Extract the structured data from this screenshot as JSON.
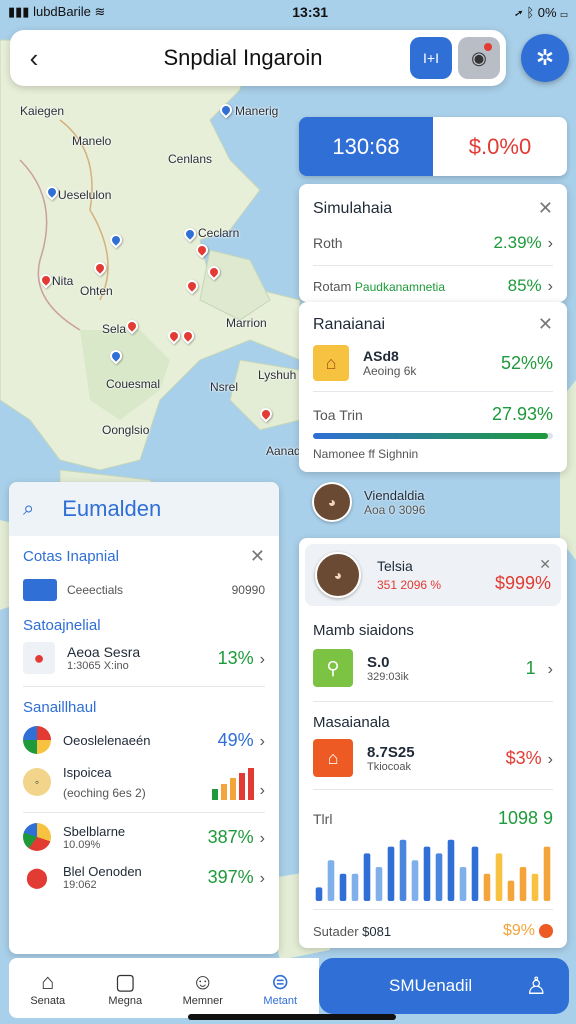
{
  "status": {
    "carrier": "lubdBarile",
    "time": "13:31",
    "battery": "0%"
  },
  "header": {
    "title": "Snpdial Ingaroin",
    "blue_button_label": "I+I"
  },
  "map": {
    "labels": [
      "Kaiegen",
      "Manerig",
      "Manelo",
      "Cenlans",
      "Ueselulon",
      "Ceclarn",
      "Ohten",
      "Nita",
      "Sela",
      "Marrion",
      "Lyshuh",
      "Nsrel",
      "Couesmal",
      "Oonglsio",
      "Aanad"
    ]
  },
  "stats": {
    "left": "130:68",
    "right": "$.0%0"
  },
  "sim_card": {
    "title": "Simulahaia",
    "rows": [
      {
        "label": "Roth",
        "value": "2.39%"
      },
      {
        "label": "Rotam",
        "sub": "Paudkanamnetia",
        "value": "85%"
      }
    ]
  },
  "ran_card": {
    "title": "Ranaianai",
    "item_title": "ASd8",
    "item_sub": "Aeoing 6k",
    "item_value": "52%%",
    "bottom_label": "Toa Trin",
    "bottom_value": "27.93%",
    "progress": 0.98,
    "footer": "Namonee ff Sighnin"
  },
  "profile_chip": {
    "name": "Viendaldia",
    "sub": "Aoa 0 3096"
  },
  "search": {
    "text": "Eumalden"
  },
  "left_list": {
    "section1": {
      "title": "Cotas Inapnial",
      "row_label": "Ceeectials",
      "row_value": "90990"
    },
    "section2": {
      "title": "Satoajnelial",
      "item_title": "Aeoa Sesra",
      "item_sub": "1:3065 X:ino",
      "item_value": "13%"
    },
    "section3": {
      "title": "Sanaillhaul",
      "rows": [
        {
          "title": "Oeoslelenaeén",
          "sub": "",
          "value": "49%"
        },
        {
          "title": "Ispoicea",
          "sub": "(eoching 6es 2)",
          "value": ""
        },
        {
          "title": "Sbelblarne",
          "sub": "10.09%",
          "value": "387%"
        },
        {
          "title": "Blel Oenoden",
          "sub": "19:062",
          "value": "397%"
        }
      ]
    }
  },
  "right_list": {
    "profile": {
      "name": "Telsia",
      "sub": "351 2096 %",
      "value": "$999%"
    },
    "item1": {
      "heading": "Mamb siaidons",
      "title": "S.0",
      "sub": "329:03ik",
      "value": "1"
    },
    "item2": {
      "heading": "Masaianala",
      "title": "8.7S25",
      "sub": "Tkiocoak",
      "value": "$3%"
    },
    "chart_label": "Tlrl",
    "chart_value": "1098 9",
    "footer_label": "Sutader",
    "footer_value": "$081",
    "footer_percent": "$9%"
  },
  "chart_data": {
    "type": "bar",
    "values": [
      2,
      6,
      4,
      4,
      7,
      5,
      8,
      9,
      6,
      8,
      7,
      9,
      5,
      8,
      4,
      7,
      3,
      5,
      4,
      8
    ],
    "ylim": [
      0,
      10
    ],
    "colors": [
      "#2f6fd6",
      "#7fb0ea",
      "#2f6fd6",
      "#7fb0ea",
      "#2f6fd6",
      "#7fb0ea",
      "#2f6fd6",
      "#4b86de",
      "#7fb0ea",
      "#2f6fd6",
      "#4b86de",
      "#2f6fd6",
      "#7fb0ea",
      "#2f6fd6",
      "#f3a43b",
      "#f7c23f",
      "#f3a43b",
      "#f3a43b",
      "#f7c23f",
      "#f3a43b"
    ]
  },
  "mini_bars": [
    30,
    45,
    60,
    75,
    90
  ],
  "bottom_nav": [
    {
      "label": "Senata",
      "icon": "home-icon",
      "active": false
    },
    {
      "label": "Megna",
      "icon": "map-icon",
      "active": false
    },
    {
      "label": "Memner",
      "icon": "profile-icon",
      "active": false
    },
    {
      "label": "Metant",
      "icon": "sliders-icon",
      "active": true
    }
  ],
  "cta": {
    "label": "SMUenadil"
  }
}
